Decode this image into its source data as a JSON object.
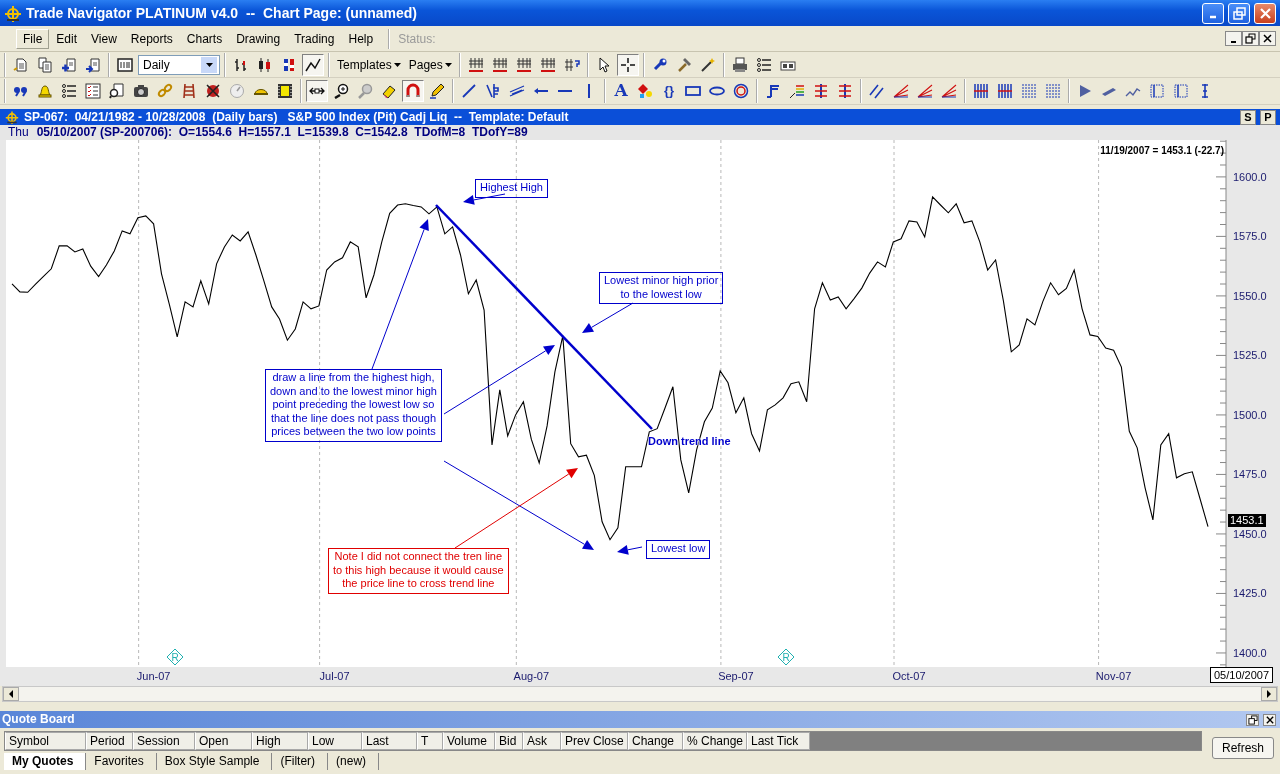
{
  "window": {
    "title": "Trade Navigator PLATINUM v4.0  --  Chart Page: (unnamed)"
  },
  "menu": [
    {
      "label": "File",
      "selected": true
    },
    {
      "label": "Edit",
      "selected": false
    },
    {
      "label": "View",
      "selected": false
    },
    {
      "label": "Reports",
      "selected": false
    },
    {
      "label": "Charts",
      "selected": false
    },
    {
      "label": "Drawing",
      "selected": false
    },
    {
      "label": "Trading",
      "selected": false
    },
    {
      "label": "Help",
      "selected": false
    }
  ],
  "status_label": "Status:",
  "toolbar": {
    "period": "Daily",
    "templates": "Templates",
    "pages": "Pages",
    "chart_types": [
      {
        "kind": "bar",
        "selected": false
      },
      {
        "kind": "candle",
        "selected": false
      },
      {
        "kind": "colorbar",
        "selected": false
      },
      {
        "kind": "line",
        "selected": true
      }
    ],
    "crosshair_on": true,
    "pan_on": true,
    "magnet_on": true,
    "text_tool": "A",
    "brace_tool": "{}"
  },
  "chart_window": {
    "header": "SP-067:  04/21/1982 - 10/28/2008  (Daily bars)   S&P 500 Index (Pit) Cadj Liq  --  Template: Default",
    "header_buttons": [
      "S",
      "P"
    ],
    "day": "Thu",
    "bar_info": "05/10/2007 (SP-200706):  O=1554.6  H=1557.1  L=1539.8  C=1542.8  TDofM=8  TDofY=89",
    "last_readout": "11/19/2007 = 1453.1 (-22.7)",
    "last_price_tag": "1453.1",
    "cursor_date": "05/10/2007",
    "chart_data": {
      "type": "line",
      "ylim": [
        1394.1,
        1615.5
      ],
      "categories": [
        null,
        null,
        null,
        null,
        null,
        null,
        null,
        null,
        null,
        null,
        null,
        null,
        null,
        null,
        null,
        null,
        null,
        null,
        "Jun-07",
        null,
        null,
        null,
        null,
        null,
        null,
        null,
        null,
        null,
        null,
        null,
        null,
        null,
        null,
        null,
        null,
        null,
        null,
        null,
        null,
        null,
        null,
        "Jul-07",
        null,
        null,
        null,
        null,
        null,
        null,
        null,
        null,
        null,
        null,
        null,
        null,
        null,
        null,
        null,
        null,
        null,
        null,
        null,
        null,
        null,
        null,
        null,
        null,
        "Aug-07",
        null,
        null,
        null,
        null,
        null,
        null,
        null,
        null,
        null,
        null,
        null,
        null,
        null,
        null,
        null,
        null,
        null,
        null,
        null,
        null,
        null,
        null,
        null,
        null,
        null,
        "Sep-07",
        null,
        null,
        null,
        null,
        null,
        null,
        null,
        null,
        null,
        null,
        null,
        null,
        null,
        null,
        null,
        null,
        null,
        null,
        null,
        null,
        null,
        "Oct-07",
        null,
        null,
        null,
        null,
        null,
        null,
        null,
        null,
        null,
        null,
        null,
        null,
        null,
        null,
        null,
        null,
        null,
        null,
        null,
        null,
        null,
        null,
        null,
        null,
        null,
        "Nov-07",
        null,
        null,
        null,
        null,
        null,
        null,
        null,
        null,
        null,
        null,
        null,
        null
      ],
      "yticks": [
        {
          "value": 1400,
          "label": "1400.0"
        },
        {
          "value": 1425,
          "label": "1425.0"
        },
        {
          "value": 1450,
          "label": "1450.0"
        },
        {
          "value": 1475,
          "label": "1475.0"
        },
        {
          "value": 1500,
          "label": "1500.0"
        },
        {
          "value": 1525,
          "label": "1525.0"
        },
        {
          "value": 1550,
          "label": "1550.0"
        },
        {
          "value": 1575,
          "label": "1575.0"
        },
        {
          "value": 1600,
          "label": "1600.0"
        }
      ],
      "series": [
        {
          "color": "#000000",
          "values": [
            1555.1,
            1551.7,
            1551.5,
            1554.9,
            1558.2,
            1561.4,
            1571.0,
            1571.0,
            1568.5,
            1569.7,
            1562.5,
            1558.1,
            1563.0,
            1568.9,
            1577.3,
            1576.1,
            1582.8,
            1583.6,
            1580.3,
            1559.3,
            1546.3,
            1532.8,
            1547.5,
            1545.4,
            1556.3,
            1546.6,
            1563.5,
            1570.6,
            1575.6,
            1573.1,
            1576.9,
            1567.2,
            1556.4,
            1545.4,
            1540.3,
            1531.4,
            1536.1,
            1547.5,
            1544.6,
            1545.8,
            1560.9,
            1564.3,
            1566.0,
            1572.7,
            1570.6,
            1549.2,
            1558.8,
            1572.7,
            1584.7,
            1588.2,
            1588.7,
            1588.0,
            1587.4,
            1584.5,
            1587.4,
            1576.1,
            1579.0,
            1567.2,
            1550.9,
            1556.7,
            1544.1,
            1487.4,
            1510.5,
            1491.2,
            1500.0,
            1505.5,
            1489.8,
            1479.8,
            1495.4,
            1518.1,
            1533.2,
            1487.9,
            1482.4,
            1483.1,
            1474.6,
            1455.1,
            1447.6,
            1452.6,
            1478.2,
            1478.2,
            1478.2,
            1492.9,
            1494.2,
            1503.0,
            1511.8,
            1481.1,
            1467.3,
            1485.3,
            1497.1,
            1502.9,
            1518.5,
            1513.5,
            1500.9,
            1507.2,
            1492.1,
            1484.9,
            1502.1,
            1504.2,
            1507.2,
            1513.1,
            1513.9,
            1505.5,
            1544.6,
            1555.5,
            1548.3,
            1549.6,
            1544.6,
            1548.8,
            1553.3,
            1559.6,
            1564.3,
            1562.2,
            1572.7,
            1574.0,
            1581.5,
            1581.1,
            1574.8,
            1591.6,
            1588.2,
            1584.9,
            1588.7,
            1580.7,
            1581.5,
            1572.7,
            1560.9,
            1565.1,
            1547.9,
            1526.5,
            1529.4,
            1540.4,
            1537.8,
            1547.6,
            1555.5,
            1550.5,
            1553.1,
            1560.9,
            1544.6,
            1533.6,
            1533.0,
            1528.1,
            1527.2,
            1520.1,
            1493.1,
            1486.2,
            1469.4,
            1455.9,
            1487.4,
            1492.1,
            1473.6,
            1475.3,
            1476.1,
            1464.7,
            1453.1
          ]
        }
      ]
    },
    "drawings": [
      {
        "kind": "trendline",
        "color": "#0000cc"
      },
      {
        "kind": "label",
        "text": "Down trend line",
        "color": "#0000cc"
      },
      {
        "kind": "note",
        "text": "Highest High",
        "color": "#0000cc"
      },
      {
        "kind": "note",
        "text": "Lowest minor high prior\nto the lowest low",
        "color": "#0000cc"
      },
      {
        "kind": "note",
        "text": "draw a line from the highest high,\ndown and to the lowest minor high\npoint preceding the lowest low so\nthat the line does not pass though\nprices between the two low points",
        "color": "#0000cc"
      },
      {
        "kind": "note",
        "text": "Note I did not connect the tren line\nto this high because it would cause\nthe price line to cross trend line",
        "color": "#e00000"
      },
      {
        "kind": "note",
        "text": "Lowest low",
        "color": "#0000cc"
      },
      {
        "kind": "marker",
        "text": "R"
      },
      {
        "kind": "marker",
        "text": "R"
      }
    ]
  },
  "quote_board": {
    "title": "Quote Board",
    "columns": [
      "Symbol",
      "Period",
      "Session",
      "Open",
      "High",
      "Low",
      "Last",
      "T",
      "Volume",
      "Bid",
      "Ask",
      "Prev Close",
      "Change",
      "% Change",
      "Last Tick"
    ],
    "refresh": "Refresh",
    "tabs": [
      {
        "label": "My Quotes",
        "selected": true
      },
      {
        "label": "Favorites",
        "selected": false
      },
      {
        "label": "Box Style Sample",
        "selected": false
      },
      {
        "label": "(Filter)",
        "selected": false
      },
      {
        "label": "(new)",
        "selected": false
      }
    ]
  }
}
